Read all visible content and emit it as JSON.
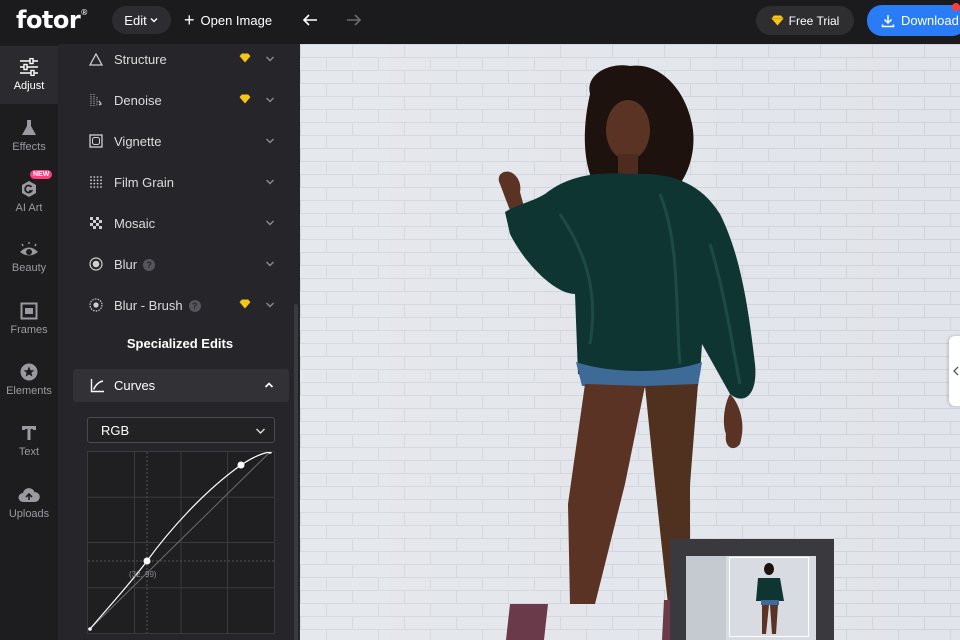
{
  "topbar": {
    "logo": "fotor",
    "logo_mark": "®",
    "edit_label": "Edit",
    "open_image_label": "Open Image",
    "free_trial_label": "Free Trial",
    "download_label": "Download"
  },
  "rail": {
    "items": [
      {
        "label": "Adjust",
        "icon": "sliders-icon"
      },
      {
        "label": "Effects",
        "icon": "flask-icon"
      },
      {
        "label": "AI Art",
        "icon": "ai-art-icon",
        "badge": "NEW"
      },
      {
        "label": "Beauty",
        "icon": "eye-icon"
      },
      {
        "label": "Frames",
        "icon": "frame-icon"
      },
      {
        "label": "Elements",
        "icon": "star-icon"
      },
      {
        "label": "Text",
        "icon": "text-icon"
      },
      {
        "label": "Uploads",
        "icon": "cloud-upload-icon"
      }
    ]
  },
  "panel": {
    "tools": [
      {
        "label": "Structure",
        "icon": "triangle-icon",
        "premium": true
      },
      {
        "label": "Denoise",
        "icon": "denoise-icon",
        "premium": true
      },
      {
        "label": "Vignette",
        "icon": "vignette-icon",
        "premium": false
      },
      {
        "label": "Film Grain",
        "icon": "grain-icon",
        "premium": false
      },
      {
        "label": "Mosaic",
        "icon": "mosaic-icon",
        "premium": false
      },
      {
        "label": "Blur",
        "icon": "blur-icon",
        "premium": false,
        "help": true
      },
      {
        "label": "Blur - Brush",
        "icon": "blur-brush-icon",
        "premium": true,
        "help": true
      }
    ],
    "section_title": "Specialized Edits",
    "curves_label": "Curves",
    "channel_value": "RGB",
    "curve_point_label": "(32, 99)"
  },
  "colors": {
    "accent": "#2a7bf6",
    "premium_gem": "#f5c518",
    "new_badge": "#ff3d7f"
  }
}
